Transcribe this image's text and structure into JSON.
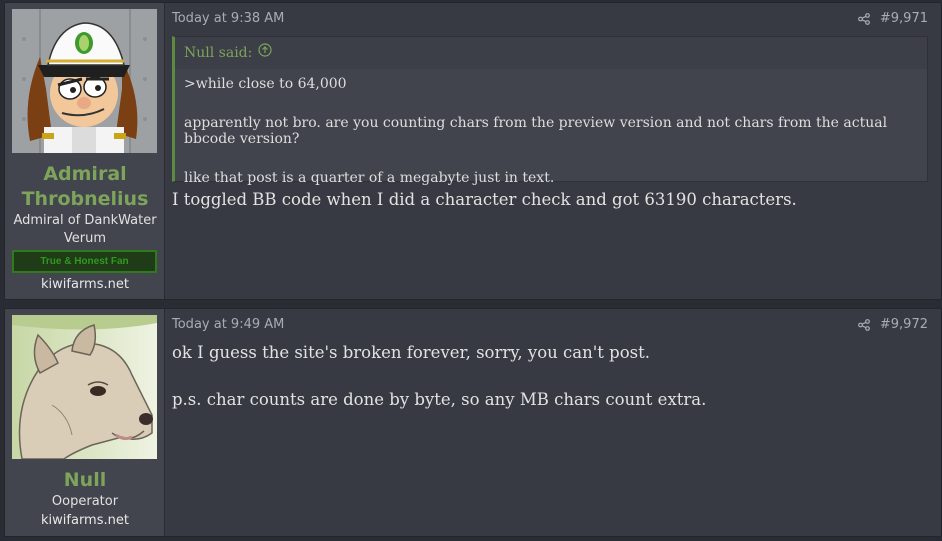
{
  "posts": [
    {
      "user": {
        "name_line1": "Admiral",
        "name_line2": "Throbnelius",
        "title_line1": "Admiral of DankWater",
        "title_line2": "Verum",
        "banner": "True & Honest Fan",
        "site": "kiwifarms.net"
      },
      "time": "Today at 9:38 AM",
      "number": "#9,971",
      "quote": {
        "author": "Null said:",
        "lines": [
          ">while close to 64,000",
          "apparently not bro. are you counting chars from the preview version and not chars from the actual bbcode version?",
          "like that post is a quarter of a megabyte just in text."
        ]
      },
      "body": [
        "I toggled BB code when I did a character check and got 63190 characters."
      ]
    },
    {
      "user": {
        "name": "Null",
        "title": "Ooperator",
        "site": "kiwifarms.net"
      },
      "time": "Today at 9:49 AM",
      "number": "#9,972",
      "body": [
        "ok I guess the site's broken forever, sorry, you can't post.",
        "p.s. char counts are done by byte, so any MB chars count extra."
      ]
    }
  ],
  "colors": {
    "username": "#7ea35a",
    "quote_accent": "#5c8a41",
    "banner": "#2f9a1e"
  }
}
